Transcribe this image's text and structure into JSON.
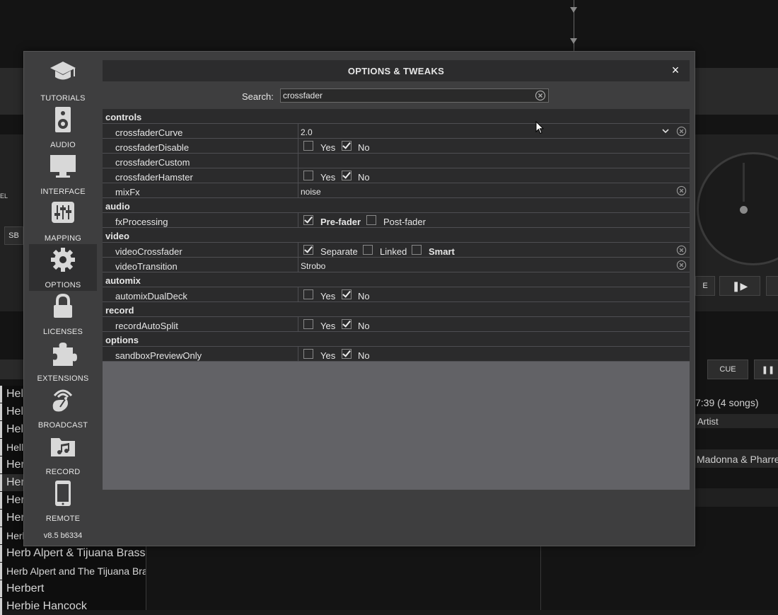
{
  "background": {
    "list_items": [
      "Helc",
      "Hell",
      "Hell",
      "Helly",
      "Her",
      "Her",
      "Herb",
      "Herb",
      "Herb",
      "Herb Alpert & Tijuana Brass",
      "Herb Alpert and The Tijuana Bras",
      "Herbert",
      "Herbie Hancock"
    ],
    "cue_label": "CUE",
    "duration_text": "7:39 (4 songs)",
    "artist_header": "Artist",
    "artist_value": "Madonna & Pharrell V",
    "partial_label_1": "EL",
    "partial_label_2": "SB",
    "partial_label_3": "E"
  },
  "dialog": {
    "title": "OPTIONS & TWEAKS",
    "close_glyph": "×",
    "search_label": "Search:",
    "search_value": "crossfader",
    "version": "v8.5 b6334"
  },
  "sidebar": {
    "items": [
      {
        "label": "TUTORIALS",
        "icon": "graduation-cap-icon"
      },
      {
        "label": "AUDIO",
        "icon": "speaker-icon"
      },
      {
        "label": "INTERFACE",
        "icon": "monitor-icon"
      },
      {
        "label": "MAPPING",
        "icon": "sliders-icon"
      },
      {
        "label": "OPTIONS",
        "icon": "gear-icon"
      },
      {
        "label": "LICENSES",
        "icon": "lock-icon"
      },
      {
        "label": "EXTENSIONS",
        "icon": "puzzle-icon"
      },
      {
        "label": "BROADCAST",
        "icon": "broadcast-icon"
      },
      {
        "label": "RECORD",
        "icon": "music-folder-icon"
      },
      {
        "label": "REMOTE",
        "icon": "tablet-icon"
      }
    ],
    "active": "OPTIONS"
  },
  "options": {
    "sections": {
      "controls": "controls",
      "audio": "audio",
      "video": "video",
      "automix": "automix",
      "record": "record",
      "options": "options"
    },
    "crossfaderCurve": {
      "name": "crossfaderCurve",
      "value": "2.0"
    },
    "crossfaderDisable": {
      "name": "crossfaderDisable",
      "yes": "Yes",
      "no": "No"
    },
    "crossfaderCustom": {
      "name": "crossfaderCustom",
      "value": ""
    },
    "crossfaderHamster": {
      "name": "crossfaderHamster",
      "yes": "Yes",
      "no": "No"
    },
    "mixFx": {
      "name": "mixFx",
      "value": "noise"
    },
    "fxProcessing": {
      "name": "fxProcessing",
      "opt1": "Pre-fader",
      "opt2": "Post-fader"
    },
    "videoCrossfader": {
      "name": "videoCrossfader",
      "opt1": "Separate",
      "opt2": "Linked",
      "opt3": "Smart"
    },
    "videoTransition": {
      "name": "videoTransition",
      "value": "Strobo"
    },
    "automixDualDeck": {
      "name": "automixDualDeck",
      "yes": "Yes",
      "no": "No"
    },
    "recordAutoSplit": {
      "name": "recordAutoSplit",
      "yes": "Yes",
      "no": "No"
    },
    "sandboxPreviewOnly": {
      "name": "sandboxPreviewOnly",
      "yes": "Yes",
      "no": "No"
    }
  }
}
